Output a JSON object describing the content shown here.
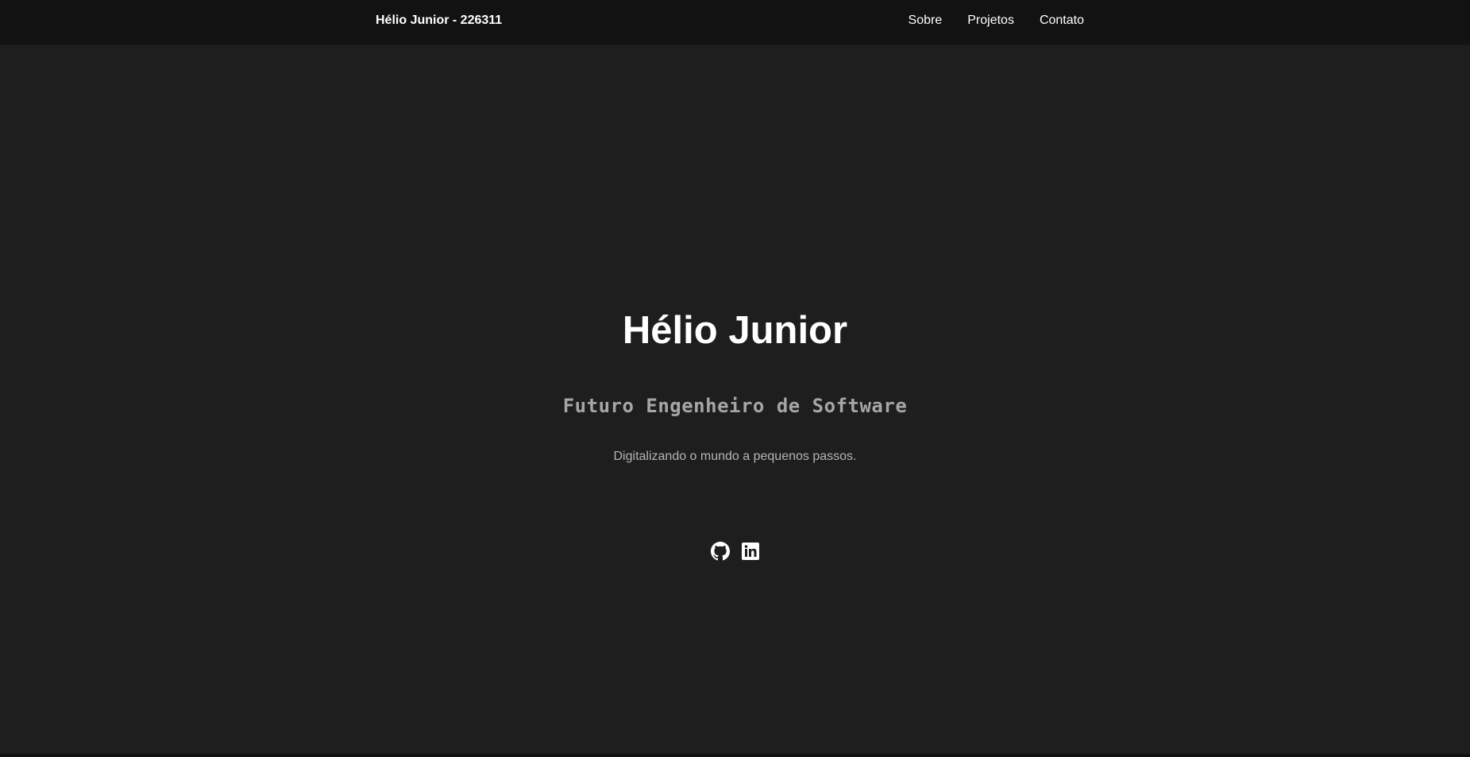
{
  "nav": {
    "brand": "Hélio Junior - 226311",
    "links": [
      {
        "label": "Sobre"
      },
      {
        "label": "Projetos"
      },
      {
        "label": "Contato"
      }
    ]
  },
  "hero": {
    "title": "Hélio Junior",
    "subtitle": "Futuro Engenheiro de Software",
    "tagline": "Digitalizando o mundo a pequenos passos."
  },
  "socials": [
    {
      "icon": "github-icon"
    },
    {
      "icon": "linkedin-icon"
    }
  ],
  "colors": {
    "background": "#1e1e1e",
    "navbar": "#121212",
    "text": "#ffffff",
    "muted": "#a6a6a6"
  }
}
